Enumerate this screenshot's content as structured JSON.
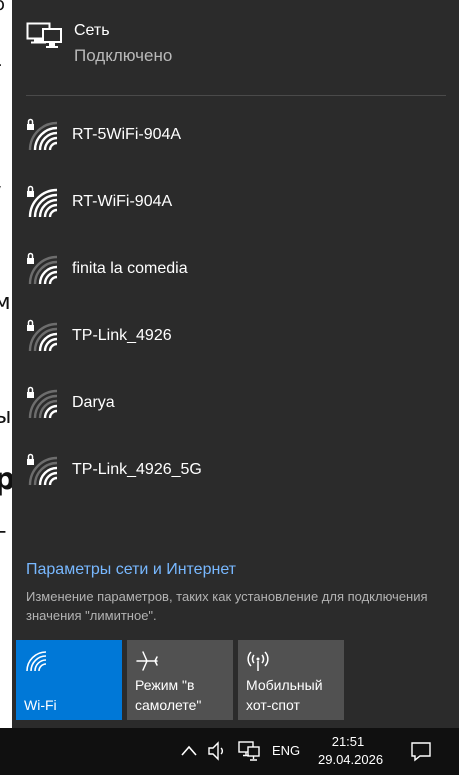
{
  "background_document": {
    "glyphs": [
      "o",
      "-",
      "/",
      "м",
      "ы",
      "р",
      "г"
    ]
  },
  "network": {
    "name": "Сеть",
    "status": "Подключено",
    "icon": "ethernet-monitor-icon"
  },
  "wifi_networks": [
    {
      "ssid": "RT-5WiFi-904A",
      "secured": true,
      "icon": "wifi-secured-icon"
    },
    {
      "ssid": "RT-WiFi-904A",
      "secured": true,
      "icon": "wifi-secured-icon"
    },
    {
      "ssid": "finita la comedia",
      "secured": true,
      "icon": "wifi-secured-icon"
    },
    {
      "ssid": "TP-Link_4926",
      "secured": true,
      "icon": "wifi-secured-icon"
    },
    {
      "ssid": "Darya",
      "secured": true,
      "icon": "wifi-secured-icon"
    },
    {
      "ssid": "TP-Link_4926_5G",
      "secured": true,
      "icon": "wifi-secured-icon"
    }
  ],
  "settings": {
    "link": "Параметры сети и Интернет",
    "description": "Изменение параметров, таких как установление для подключения значения \"лимитное\"."
  },
  "quick_actions": [
    {
      "label": "Wi-Fi",
      "active": true,
      "icon": "wifi-icon"
    },
    {
      "label": "Режим \"в самолете\"",
      "active": false,
      "icon": "airplane-icon"
    },
    {
      "label": "Мобильный хот-спот",
      "active": false,
      "icon": "mobile-hotspot-icon"
    }
  ],
  "taskbar": {
    "language": "ENG",
    "time": "21:51",
    "date": "29.04.2026",
    "icons": [
      "chevron-up-icon",
      "volume-icon",
      "network-icon",
      "notifications-icon"
    ]
  },
  "colors": {
    "flyout_bg": "#2b2b2b",
    "accent": "#0078d7",
    "link": "#78b8ff",
    "tile_bg": "#515151",
    "taskbar_bg": "#101010"
  }
}
